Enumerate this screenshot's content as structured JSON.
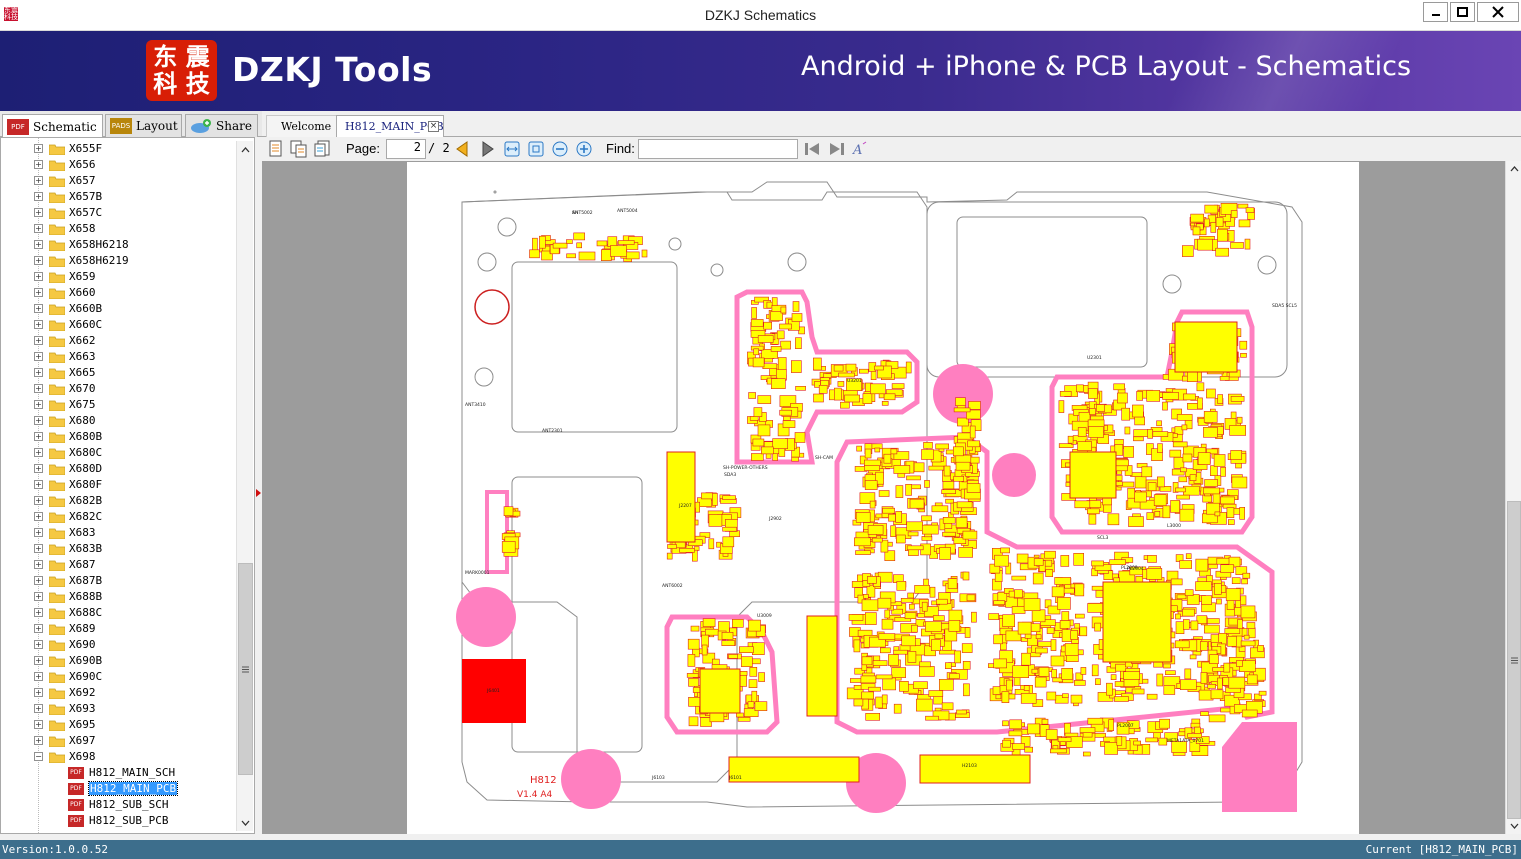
{
  "window": {
    "title": "DZKJ Schematics",
    "controls": {
      "minimize": "minimize-icon",
      "maximize": "maximize-icon",
      "close": "close-icon"
    }
  },
  "banner": {
    "logo_chars": [
      "东",
      "震",
      "科",
      "技"
    ],
    "brand": "DZKJ Tools",
    "slogan": "Android + iPhone & PCB Layout - Schematics"
  },
  "left_tabs": [
    {
      "label": "Schematic",
      "icon": "PDF",
      "active": true
    },
    {
      "label": "Layout",
      "icon": "PADS",
      "active": false
    },
    {
      "label": "Share",
      "icon": "share-icon",
      "active": false
    }
  ],
  "tree": {
    "folders": [
      "X655F",
      "X656",
      "X657",
      "X657B",
      "X657C",
      "X658",
      "X658H6218",
      "X658H6219",
      "X659",
      "X660",
      "X660B",
      "X660C",
      "X662",
      "X663",
      "X665",
      "X670",
      "X675",
      "X680",
      "X680B",
      "X680C",
      "X680D",
      "X680F",
      "X682B",
      "X682C",
      "X683",
      "X683B",
      "X687",
      "X687B",
      "X688B",
      "X688C",
      "X689",
      "X690",
      "X690B",
      "X690C",
      "X692",
      "X693",
      "X695",
      "X697"
    ],
    "expanded_folder": "X698",
    "files": [
      "H812_MAIN_SCH",
      "H812_MAIN_PCB",
      "H812_SUB_SCH",
      "H812_SUB_PCB"
    ],
    "selected_file": "H812_MAIN_PCB",
    "file_icon": "PDF"
  },
  "doc_tabs": [
    {
      "label": "Welcome",
      "active": false
    },
    {
      "label": "H812_MAIN_PCB",
      "active": true,
      "closable": true
    }
  ],
  "toolbar": {
    "page_label": "Page:",
    "page_current": "2",
    "page_total": "/ 2",
    "find_label": "Find:",
    "find_value": ""
  },
  "board": {
    "title": "H812",
    "version": "V1.4  A4",
    "labels": [
      "ANT5002",
      "ANT5004",
      "ANT3410",
      "ANT2301",
      "ANT6002",
      "U3009",
      "U2301",
      "U3201",
      "J6101",
      "J6103",
      "J2902",
      "J2207",
      "PL2004",
      "PL2009",
      "PL2007",
      "L3000",
      "SDA5 SCL5",
      "MARK0001",
      "SH-CAM",
      "SH-POWER-OTHERS",
      "SDA3",
      "SCL3",
      "META1ATA_0701",
      "H2103",
      "J6401",
      "SH"
    ],
    "colors": {
      "board_outline": "#8c8c8c",
      "pad_fill": "#ffff00",
      "pad_outline": "#e02020",
      "keepout": "#ff7fc0",
      "shield": "#ff0000"
    }
  },
  "status": {
    "version": "Version:1.0.0.52",
    "current": "Current [H812_MAIN_PCB]"
  }
}
